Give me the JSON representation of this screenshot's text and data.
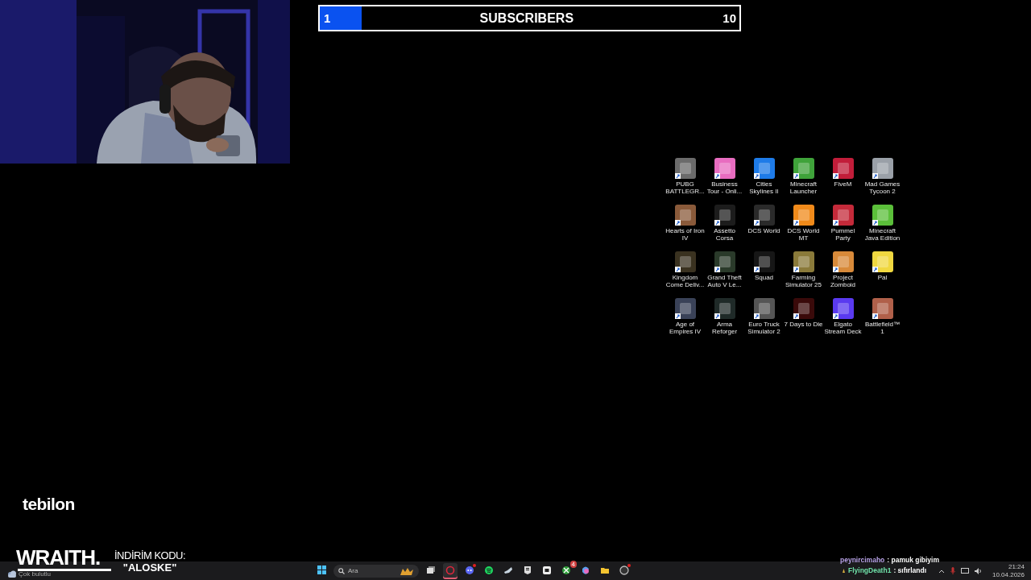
{
  "subscriber_goal": {
    "current": "1",
    "label": "SUBSCRIBERS",
    "target": "10",
    "level": 0.1
  },
  "desktop_icons": [
    {
      "label": "PUBG BATTLEGR...",
      "color": "#6b6b6b"
    },
    {
      "label": "Business Tour - Onli...",
      "color": "#e86cc0"
    },
    {
      "label": "Cities Skylines II",
      "color": "#1e7be8"
    },
    {
      "label": "Minecraft Launcher",
      "color": "#3fa33a"
    },
    {
      "label": "FiveM",
      "color": "#c21d3a"
    },
    {
      "label": "Mad Games Tycoon 2",
      "color": "#9aa0a8"
    },
    {
      "label": "Hearts of Iron IV",
      "color": "#8a5a3a"
    },
    {
      "label": "Assetto Corsa",
      "color": "#1c1c1c"
    },
    {
      "label": "DCS World",
      "color": "#2a2a2a"
    },
    {
      "label": "DCS World MT",
      "color": "#f08a1a"
    },
    {
      "label": "Pummel Party",
      "color": "#c42a3a"
    },
    {
      "label": "Minecraft Java Edition",
      "color": "#5bbf3a"
    },
    {
      "label": "Kingdom Come Deliv...",
      "color": "#3a3220"
    },
    {
      "label": "Grand Theft Auto V Le...",
      "color": "#2a3a2a"
    },
    {
      "label": "Squad",
      "color": "#161616"
    },
    {
      "label": "Farming Simulator 25",
      "color": "#8a7a3a"
    },
    {
      "label": "Project Zomboid",
      "color": "#d88a3a"
    },
    {
      "label": "Pal",
      "color": "#f0d840"
    },
    {
      "label": "Age of Empires IV",
      "color": "#3a4258"
    },
    {
      "label": "Arma Reforger",
      "color": "#1f2a28"
    },
    {
      "label": "Euro Truck Simulator 2",
      "color": "#555555"
    },
    {
      "label": "7 Days to Die",
      "color": "#3a0a0a"
    },
    {
      "label": "Elgato Stream Deck",
      "color": "#5a3af0"
    },
    {
      "label": "Battlefield™ 1",
      "color": "#b0604a"
    }
  ],
  "sponsor_logo": "tebilon",
  "promo": {
    "brand": "WRAITH.",
    "label": "İNDİRİM KODU:",
    "code": "\"ALOSKE\""
  },
  "taskbar": {
    "weather": "Çok bulutlu",
    "search_placeholder": "Ara",
    "apps": [
      {
        "kind": "taskview",
        "selected": false,
        "notification": false
      },
      {
        "kind": "ring",
        "selected": true,
        "notification": false
      },
      {
        "kind": "chat",
        "selected": false,
        "notification": true
      },
      {
        "kind": "music",
        "selected": false,
        "notification": false
      },
      {
        "kind": "steam",
        "selected": false,
        "notification": false
      },
      {
        "kind": "epic",
        "selected": false,
        "notification": false
      },
      {
        "kind": "square",
        "selected": false,
        "notification": false
      },
      {
        "kind": "xbox",
        "selected": false,
        "notification": false,
        "badge": "4"
      },
      {
        "kind": "copilot",
        "selected": false,
        "notification": false
      },
      {
        "kind": "folder",
        "selected": false,
        "notification": false
      },
      {
        "kind": "app",
        "selected": false,
        "notification": true
      }
    ],
    "time": "21:24",
    "date": "10.04.2026"
  },
  "chat": [
    {
      "user": "peynircimaho",
      "message": ": pamuk gibiyim",
      "color": "#b9a3e8",
      "badge": false
    },
    {
      "user": "FlyingDeath1",
      "message": ": sıfırlandı",
      "color": "#6fe0a8",
      "badge": true
    }
  ]
}
